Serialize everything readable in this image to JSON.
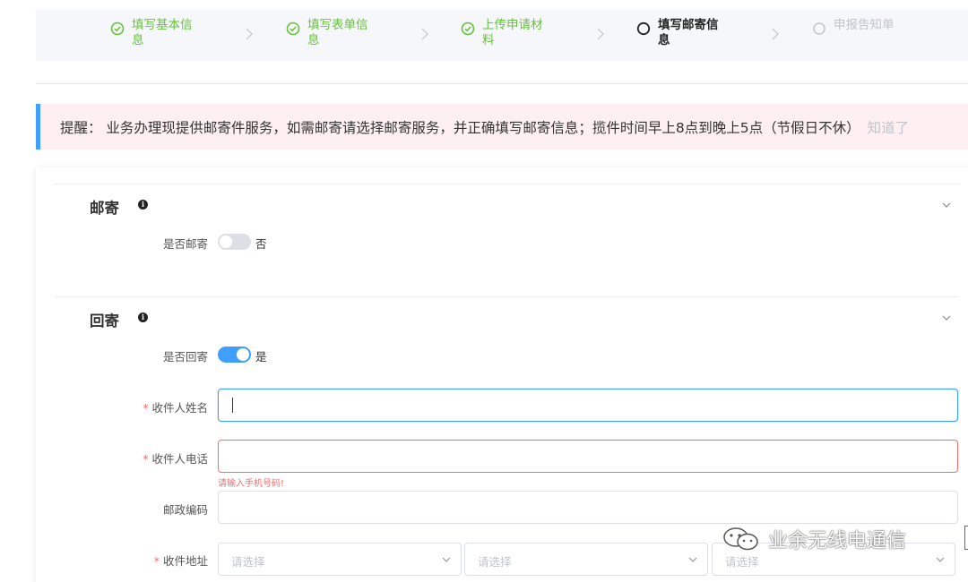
{
  "steps": [
    {
      "label": "填写基本信息",
      "state": "done",
      "icon": "check-circle-icon"
    },
    {
      "label": "填写表单信息",
      "state": "done",
      "icon": "check-circle-icon"
    },
    {
      "label": "上传申请材料",
      "state": "done",
      "icon": "check-circle-icon"
    },
    {
      "label": "填写邮寄信息",
      "state": "active",
      "icon": "circle-icon"
    },
    {
      "label": "申报告知单",
      "state": "todo",
      "icon": "circle-icon"
    }
  ],
  "notice": {
    "text": "提醒： 业务办理现提供邮寄件服务，如需邮寄请选择邮寄服务，并正确填写邮寄信息；揽件时间早上8点到晚上5点（节假日不休）",
    "ack_label": "知道了"
  },
  "mail_section": {
    "title": "邮寄",
    "toggle_label": "是否邮寄",
    "toggle_value_text": "否",
    "toggle_on": false
  },
  "return_section": {
    "title": "回寄",
    "toggle_label": "是否回寄",
    "toggle_value_text": "是",
    "toggle_on": true,
    "fields": {
      "recipient_name": {
        "label": "收件人姓名",
        "required": "*",
        "value": ""
      },
      "recipient_phone": {
        "label": "收件人电话",
        "required": "*",
        "value": "",
        "error": "请输入手机号码!"
      },
      "postal_code": {
        "label": "邮政编码",
        "value": ""
      },
      "address": {
        "label": "收件地址",
        "required": "*",
        "selects": [
          "请选择",
          "请选择",
          "请选择"
        ]
      }
    }
  },
  "watermark": {
    "text": "业余无线电通信",
    "icon": "wechat-icon"
  },
  "colors": {
    "success": "#67c23a",
    "primary": "#409eff",
    "danger": "#f56c6c",
    "muted": "#c0c4cc",
    "notice_bg": "#fef0f0"
  }
}
